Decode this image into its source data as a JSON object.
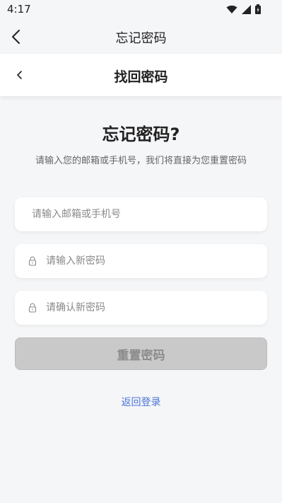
{
  "status_bar": {
    "time": "4:17",
    "icons": [
      "wifi-icon",
      "signal-icon",
      "battery-icon"
    ]
  },
  "app_header": {
    "title": "忘记密码",
    "back_icon": "chevron-left-icon"
  },
  "card_header": {
    "title": "找回密码",
    "back_icon": "chevron-left-icon"
  },
  "main": {
    "heading": "忘记密码?",
    "subtext": "请输入您的邮箱或手机号，我们将直接为您重置密码"
  },
  "form": {
    "email_placeholder": "请输入邮箱或手机号",
    "email_value": "",
    "new_password_placeholder": "请输入新密码",
    "new_password_value": "",
    "confirm_password_placeholder": "请确认新密码",
    "confirm_password_value": "",
    "lock_icon": "lock-icon",
    "reset_button_label": "重置密码",
    "back_to_login_label": "返回登录"
  },
  "colors": {
    "background": "#f5f6f8",
    "card": "#ffffff",
    "button_disabled_bg": "#c9c9c9",
    "button_disabled_text": "#8b8b8b",
    "link": "#4a74d9"
  }
}
